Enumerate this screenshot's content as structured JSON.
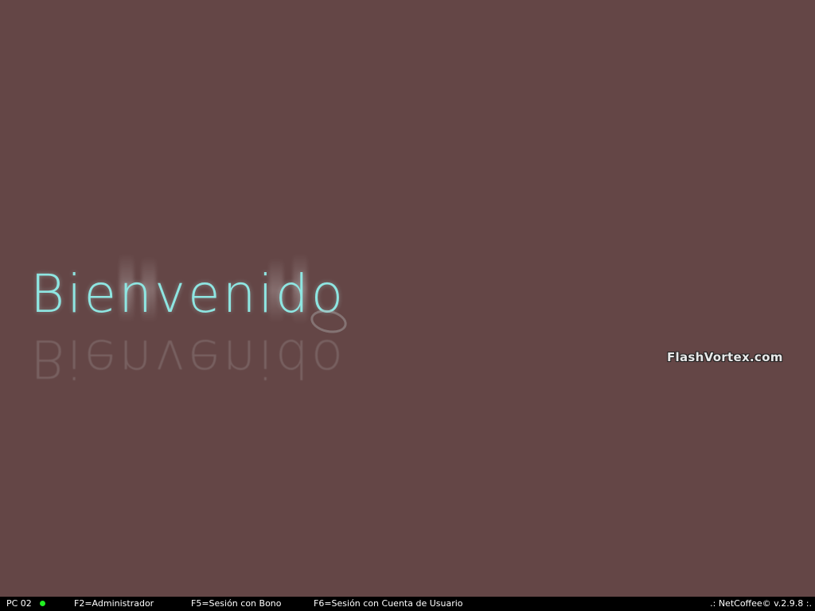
{
  "welcome": {
    "text": "Bienvenido"
  },
  "watermark": {
    "text": "FlashVortex.com"
  },
  "statusbar": {
    "pc_label": "PC 02",
    "status_color": "#22ee22",
    "shortcuts": [
      {
        "label": "F2=Administrador"
      },
      {
        "label": "F5=Sesión con Bono"
      },
      {
        "label": "F6=Sesión con Cuenta de Usuario"
      }
    ],
    "version": ".: NetCoffee© v.2.9.8 :."
  }
}
